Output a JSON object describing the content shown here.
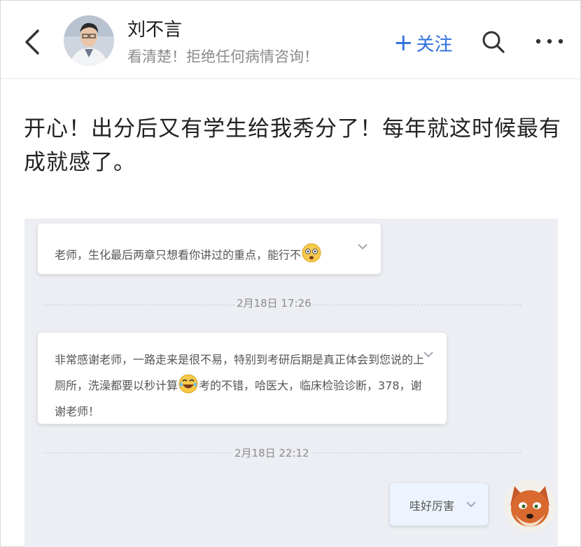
{
  "header": {
    "user_name": "刘不言",
    "signature": "看清楚！拒绝任何病情咨询！",
    "follow_label": "关注",
    "follow_plus": "+",
    "accent_color": "#2f6fdd"
  },
  "post": {
    "text": "开心！出分后又有学生给我秀分了！每年就这时候最有成就感了。"
  },
  "chat": {
    "messages": [
      {
        "text": "老师，生化最后两章只想看你讲过的重点，能行不"
      },
      {
        "timestamp": "2月18日 17:26"
      },
      {
        "text_before_emoji": "非常感谢老师，一路走来是很不易，特别到考研后期是真正体会到您说的上厕所，洗澡都要以秒计算",
        "text_after_emoji": "考的不错，哈医大，临床检验诊断，378，谢谢老师！"
      },
      {
        "timestamp": "2月18日 22:12"
      },
      {
        "text": "哇好厉害"
      }
    ]
  },
  "icons": [
    "back-arrow-icon",
    "search-icon",
    "more-icon",
    "chevron-down-icon",
    "fearful-emoji-icon",
    "laughing-emoji-icon",
    "fox-sticker"
  ]
}
